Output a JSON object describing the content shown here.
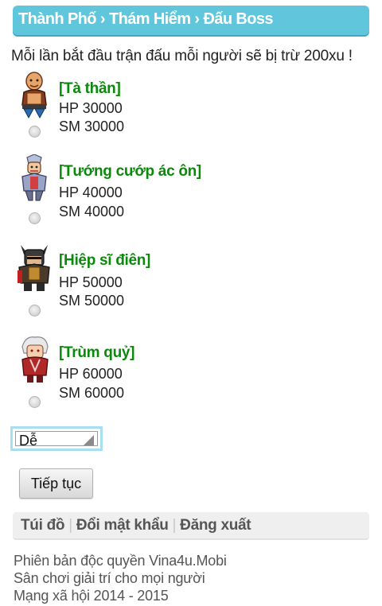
{
  "breadcrumb": {
    "items": [
      "Thành Phố",
      "Thám Hiểm",
      "Đấu Boss"
    ],
    "separator": "›"
  },
  "notice": "Mỗi lần bắt đầu trận đấu mỗi người sẽ bị trừ 200xu !",
  "bosses": [
    {
      "name": "[Tà thần]",
      "hp": "HP 30000",
      "sm": "SM 30000",
      "icon": "bald-monk-icon"
    },
    {
      "name": "[Tướng cướp ác ôn]",
      "hp": "HP 40000",
      "sm": "SM 40000",
      "icon": "bandit-general-icon"
    },
    {
      "name": "[Hiệp sĩ điên]",
      "hp": "HP 50000",
      "sm": "SM 50000",
      "icon": "horned-knight-icon"
    },
    {
      "name": "[Trùm quỷ]",
      "hp": "HP 60000",
      "sm": "SM 60000",
      "icon": "demon-boss-icon"
    }
  ],
  "difficulty": {
    "selected": "Dễ"
  },
  "continue_button": "Tiếp tục",
  "menu": {
    "items": [
      "Túi đồ",
      "Đổi mật khẩu",
      "Đăng xuất"
    ]
  },
  "footer": {
    "lines": [
      "Phiên bản độc quyền Vina4u.Mobi",
      "Sân chơi giải trí cho mọi người",
      "Mạng xã hội 2014 - 2015"
    ]
  },
  "colors": {
    "header_bg": "#5fc6dc",
    "boss_name": "#0a8a0a"
  }
}
